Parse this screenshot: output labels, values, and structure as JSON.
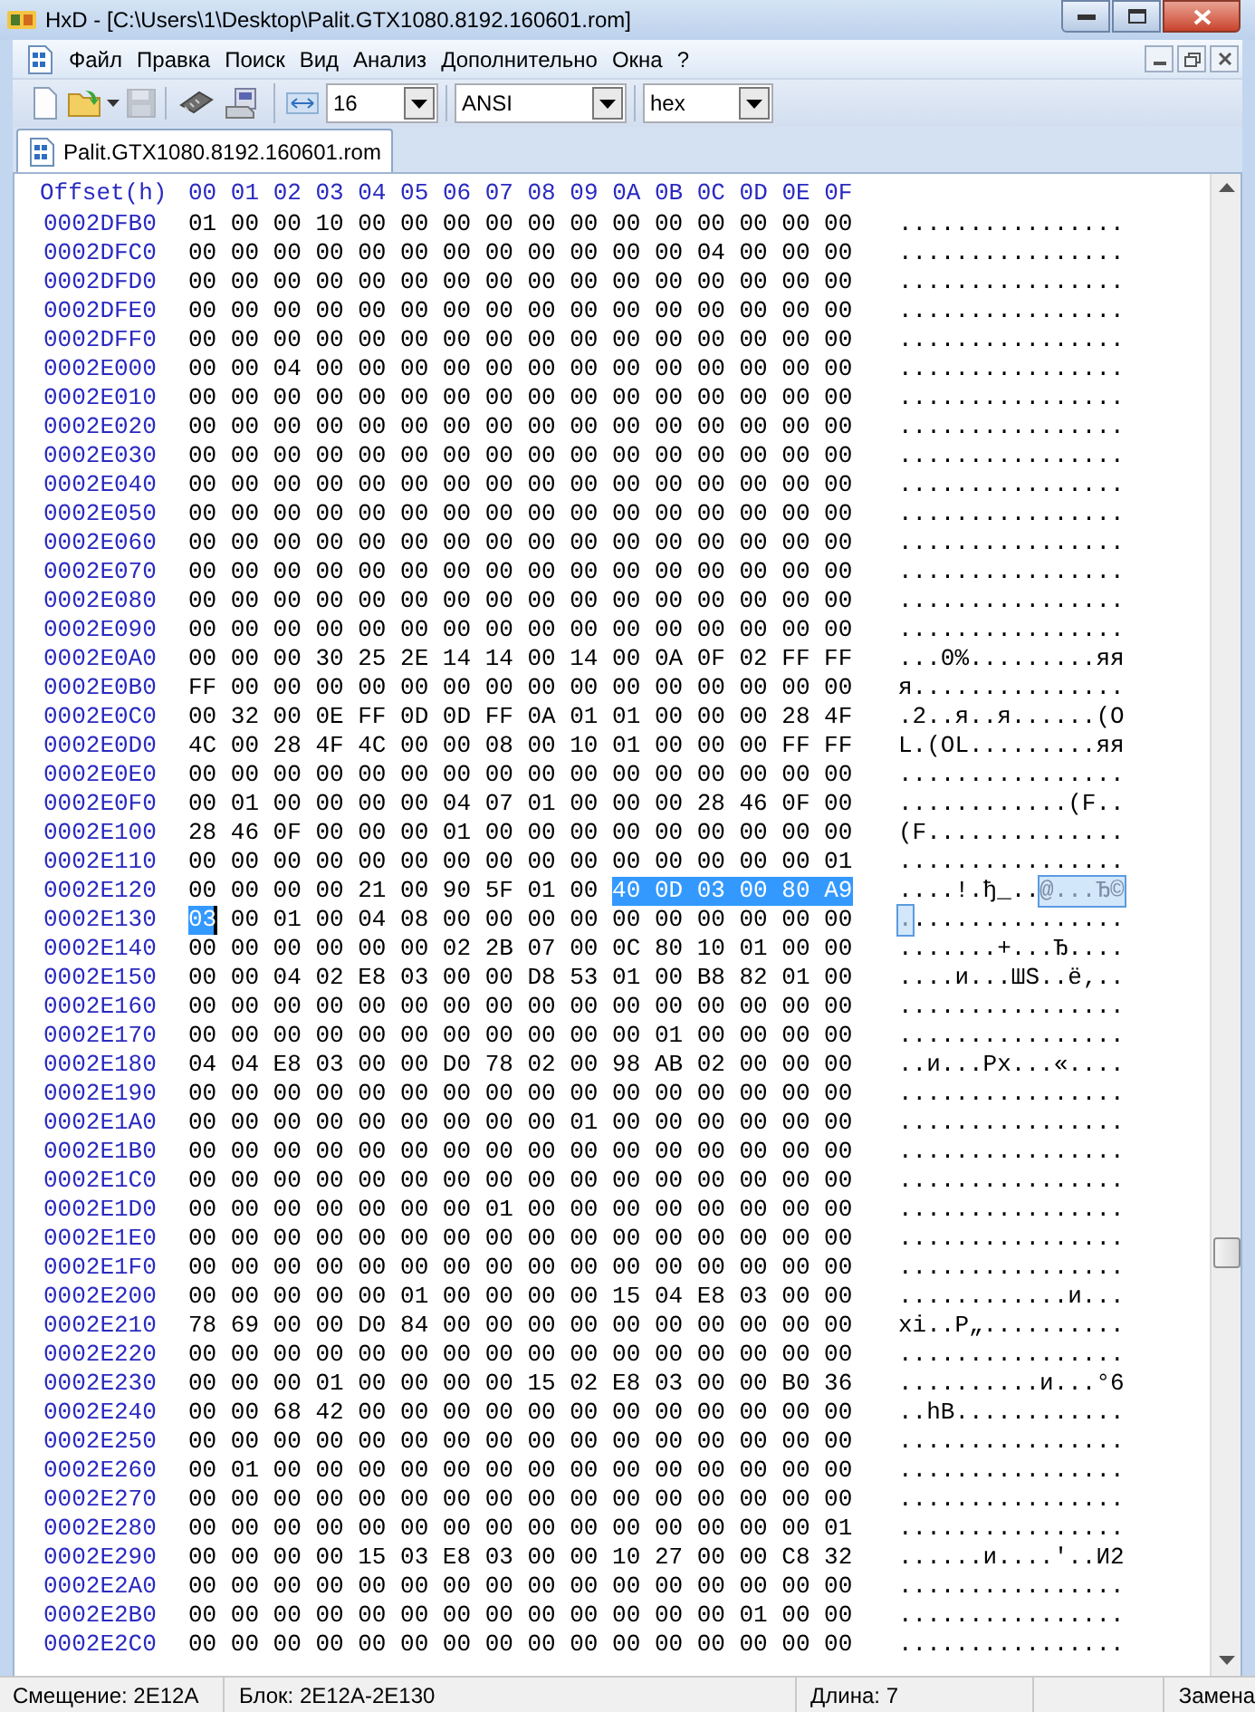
{
  "window": {
    "title": "HxD - [C:\\Users\\1\\Desktop\\Palit.GTX1080.8192.160601.rom]"
  },
  "menu": [
    "Файл",
    "Правка",
    "Поиск",
    "Вид",
    "Анализ",
    "Дополнительно",
    "Окна",
    "?"
  ],
  "toolbar": {
    "tools": [
      {
        "kind": "new",
        "disabled": false
      },
      {
        "kind": "open",
        "disabled": false
      },
      {
        "kind": "save",
        "disabled": true
      },
      {
        "kind": "ram",
        "disabled": false
      },
      {
        "kind": "disk",
        "disabled": false
      }
    ],
    "combos": [
      {
        "value": "16"
      },
      {
        "value": "ANSI"
      },
      {
        "value": "hex"
      }
    ]
  },
  "tabs": [
    {
      "label": "Palit.GTX1080.8192.160601.rom",
      "selected": true
    }
  ],
  "editor": {
    "offset_header": "Offset(h)",
    "hex_pane_focused": true,
    "columns": [
      "00",
      "01",
      "02",
      "03",
      "04",
      "05",
      "06",
      "07",
      "08",
      "09",
      "0A",
      "0B",
      "0C",
      "0D",
      "0E",
      "0F"
    ],
    "rows": [
      {
        "offset": "0002DFB0",
        "hex": [
          {
            "text": "01 00 00 10 00 00 00 00 00 00 00 00 00 00 00 00",
            "selected": false,
            "caret": false
          }
        ],
        "ascii": [
          {
            "text": "................",
            "selected": false
          }
        ]
      },
      {
        "offset": "0002DFC0",
        "hex": [
          {
            "text": "00 00 00 00 00 00 00 00 00 00 00 00 04 00 00 00",
            "selected": false,
            "caret": false
          }
        ],
        "ascii": [
          {
            "text": "................",
            "selected": false
          }
        ]
      },
      {
        "offset": "0002DFD0",
        "hex": [
          {
            "text": "00 00 00 00 00 00 00 00 00 00 00 00 00 00 00 00",
            "selected": false,
            "caret": false
          }
        ],
        "ascii": [
          {
            "text": "................",
            "selected": false
          }
        ]
      },
      {
        "offset": "0002DFE0",
        "hex": [
          {
            "text": "00 00 00 00 00 00 00 00 00 00 00 00 00 00 00 00",
            "selected": false,
            "caret": false
          }
        ],
        "ascii": [
          {
            "text": "................",
            "selected": false
          }
        ]
      },
      {
        "offset": "0002DFF0",
        "hex": [
          {
            "text": "00 00 00 00 00 00 00 00 00 00 00 00 00 00 00 00",
            "selected": false,
            "caret": false
          }
        ],
        "ascii": [
          {
            "text": "................",
            "selected": false
          }
        ]
      },
      {
        "offset": "0002E000",
        "hex": [
          {
            "text": "00 00 04 00 00 00 00 00 00 00 00 00 00 00 00 00",
            "selected": false,
            "caret": false
          }
        ],
        "ascii": [
          {
            "text": "................",
            "selected": false
          }
        ]
      },
      {
        "offset": "0002E010",
        "hex": [
          {
            "text": "00 00 00 00 00 00 00 00 00 00 00 00 00 00 00 00",
            "selected": false,
            "caret": false
          }
        ],
        "ascii": [
          {
            "text": "................",
            "selected": false
          }
        ]
      },
      {
        "offset": "0002E020",
        "hex": [
          {
            "text": "00 00 00 00 00 00 00 00 00 00 00 00 00 00 00 00",
            "selected": false,
            "caret": false
          }
        ],
        "ascii": [
          {
            "text": "................",
            "selected": false
          }
        ]
      },
      {
        "offset": "0002E030",
        "hex": [
          {
            "text": "00 00 00 00 00 00 00 00 00 00 00 00 00 00 00 00",
            "selected": false,
            "caret": false
          }
        ],
        "ascii": [
          {
            "text": "................",
            "selected": false
          }
        ]
      },
      {
        "offset": "0002E040",
        "hex": [
          {
            "text": "00 00 00 00 00 00 00 00 00 00 00 00 00 00 00 00",
            "selected": false,
            "caret": false
          }
        ],
        "ascii": [
          {
            "text": "................",
            "selected": false
          }
        ]
      },
      {
        "offset": "0002E050",
        "hex": [
          {
            "text": "00 00 00 00 00 00 00 00 00 00 00 00 00 00 00 00",
            "selected": false,
            "caret": false
          }
        ],
        "ascii": [
          {
            "text": "................",
            "selected": false
          }
        ]
      },
      {
        "offset": "0002E060",
        "hex": [
          {
            "text": "00 00 00 00 00 00 00 00 00 00 00 00 00 00 00 00",
            "selected": false,
            "caret": false
          }
        ],
        "ascii": [
          {
            "text": "................",
            "selected": false
          }
        ]
      },
      {
        "offset": "0002E070",
        "hex": [
          {
            "text": "00 00 00 00 00 00 00 00 00 00 00 00 00 00 00 00",
            "selected": false,
            "caret": false
          }
        ],
        "ascii": [
          {
            "text": "................",
            "selected": false
          }
        ]
      },
      {
        "offset": "0002E080",
        "hex": [
          {
            "text": "00 00 00 00 00 00 00 00 00 00 00 00 00 00 00 00",
            "selected": false,
            "caret": false
          }
        ],
        "ascii": [
          {
            "text": "................",
            "selected": false
          }
        ]
      },
      {
        "offset": "0002E090",
        "hex": [
          {
            "text": "00 00 00 00 00 00 00 00 00 00 00 00 00 00 00 00",
            "selected": false,
            "caret": false
          }
        ],
        "ascii": [
          {
            "text": "................",
            "selected": false
          }
        ]
      },
      {
        "offset": "0002E0A0",
        "hex": [
          {
            "text": "00 00 00 30 25 2E 14 14 00 14 00 0A 0F 02 FF FF",
            "selected": false,
            "caret": false
          }
        ],
        "ascii": [
          {
            "text": "...0%.........яя",
            "selected": false
          }
        ]
      },
      {
        "offset": "0002E0B0",
        "hex": [
          {
            "text": "FF 00 00 00 00 00 00 00 00 00 00 00 00 00 00 00",
            "selected": false,
            "caret": false
          }
        ],
        "ascii": [
          {
            "text": "я...............",
            "selected": false
          }
        ]
      },
      {
        "offset": "0002E0C0",
        "hex": [
          {
            "text": "00 32 00 0E FF 0D 0D FF 0A 01 01 00 00 00 28 4F",
            "selected": false,
            "caret": false
          }
        ],
        "ascii": [
          {
            "text": ".2..я..я......(O",
            "selected": false
          }
        ]
      },
      {
        "offset": "0002E0D0",
        "hex": [
          {
            "text": "4C 00 28 4F 4C 00 00 08 00 10 01 00 00 00 FF FF",
            "selected": false,
            "caret": false
          }
        ],
        "ascii": [
          {
            "text": "L.(OL.........яя",
            "selected": false
          }
        ]
      },
      {
        "offset": "0002E0E0",
        "hex": [
          {
            "text": "00 00 00 00 00 00 00 00 00 00 00 00 00 00 00 00",
            "selected": false,
            "caret": false
          }
        ],
        "ascii": [
          {
            "text": "................",
            "selected": false
          }
        ]
      },
      {
        "offset": "0002E0F0",
        "hex": [
          {
            "text": "00 01 00 00 00 00 04 07 01 00 00 00 28 46 0F 00",
            "selected": false,
            "caret": false
          }
        ],
        "ascii": [
          {
            "text": "............(F..",
            "selected": false
          }
        ]
      },
      {
        "offset": "0002E100",
        "hex": [
          {
            "text": "28 46 0F 00 00 00 01 00 00 00 00 00 00 00 00 00",
            "selected": false,
            "caret": false
          }
        ],
        "ascii": [
          {
            "text": "(F..............",
            "selected": false
          }
        ]
      },
      {
        "offset": "0002E110",
        "hex": [
          {
            "text": "00 00 00 00 00 00 00 00 00 00 00 00 00 00 00 01",
            "selected": false,
            "caret": false
          }
        ],
        "ascii": [
          {
            "text": "................",
            "selected": false
          }
        ]
      },
      {
        "offset": "0002E120",
        "hex": [
          {
            "text": "00 00 00 00 21 00 90 5F 01 00",
            "selected": false,
            "caret": false
          },
          {
            "text": "40 0D 03 00 80 A9",
            "selected": true,
            "caret": false
          }
        ],
        "ascii": [
          {
            "text": "....!.ђ_..",
            "selected": false
          },
          {
            "text": "@...Ђ©",
            "selected": true
          }
        ]
      },
      {
        "offset": "0002E130",
        "hex": [
          {
            "text": "03",
            "selected": true,
            "caret": true
          },
          {
            "text": "00 01 00 04 08 00 00 00 00 00 00 00 00 00 00",
            "selected": false,
            "caret": false
          }
        ],
        "ascii": [
          {
            "text": ".",
            "selected": true
          },
          {
            "text": "...............",
            "selected": false
          }
        ]
      },
      {
        "offset": "0002E140",
        "hex": [
          {
            "text": "00 00 00 00 00 00 02 2B 07 00 0C 80 10 01 00 00",
            "selected": false,
            "caret": false
          }
        ],
        "ascii": [
          {
            "text": ".......+...Ђ....",
            "selected": false
          }
        ]
      },
      {
        "offset": "0002E150",
        "hex": [
          {
            "text": "00 00 04 02 E8 03 00 00 D8 53 01 00 B8 82 01 00",
            "selected": false,
            "caret": false
          }
        ],
        "ascii": [
          {
            "text": "....и...ШS..ё‚..",
            "selected": false
          }
        ]
      },
      {
        "offset": "0002E160",
        "hex": [
          {
            "text": "00 00 00 00 00 00 00 00 00 00 00 00 00 00 00 00",
            "selected": false,
            "caret": false
          }
        ],
        "ascii": [
          {
            "text": "................",
            "selected": false
          }
        ]
      },
      {
        "offset": "0002E170",
        "hex": [
          {
            "text": "00 00 00 00 00 00 00 00 00 00 00 01 00 00 00 00",
            "selected": false,
            "caret": false
          }
        ],
        "ascii": [
          {
            "text": "................",
            "selected": false
          }
        ]
      },
      {
        "offset": "0002E180",
        "hex": [
          {
            "text": "04 04 E8 03 00 00 D0 78 02 00 98 AB 02 00 00 00",
            "selected": false,
            "caret": false
          }
        ],
        "ascii": [
          {
            "text": "..и...Рx...«....",
            "selected": false
          }
        ]
      },
      {
        "offset": "0002E190",
        "hex": [
          {
            "text": "00 00 00 00 00 00 00 00 00 00 00 00 00 00 00 00",
            "selected": false,
            "caret": false
          }
        ],
        "ascii": [
          {
            "text": "................",
            "selected": false
          }
        ]
      },
      {
        "offset": "0002E1A0",
        "hex": [
          {
            "text": "00 00 00 00 00 00 00 00 00 01 00 00 00 00 00 00",
            "selected": false,
            "caret": false
          }
        ],
        "ascii": [
          {
            "text": "................",
            "selected": false
          }
        ]
      },
      {
        "offset": "0002E1B0",
        "hex": [
          {
            "text": "00 00 00 00 00 00 00 00 00 00 00 00 00 00 00 00",
            "selected": false,
            "caret": false
          }
        ],
        "ascii": [
          {
            "text": "................",
            "selected": false
          }
        ]
      },
      {
        "offset": "0002E1C0",
        "hex": [
          {
            "text": "00 00 00 00 00 00 00 00 00 00 00 00 00 00 00 00",
            "selected": false,
            "caret": false
          }
        ],
        "ascii": [
          {
            "text": "................",
            "selected": false
          }
        ]
      },
      {
        "offset": "0002E1D0",
        "hex": [
          {
            "text": "00 00 00 00 00 00 00 01 00 00 00 00 00 00 00 00",
            "selected": false,
            "caret": false
          }
        ],
        "ascii": [
          {
            "text": "................",
            "selected": false
          }
        ]
      },
      {
        "offset": "0002E1E0",
        "hex": [
          {
            "text": "00 00 00 00 00 00 00 00 00 00 00 00 00 00 00 00",
            "selected": false,
            "caret": false
          }
        ],
        "ascii": [
          {
            "text": "................",
            "selected": false
          }
        ]
      },
      {
        "offset": "0002E1F0",
        "hex": [
          {
            "text": "00 00 00 00 00 00 00 00 00 00 00 00 00 00 00 00",
            "selected": false,
            "caret": false
          }
        ],
        "ascii": [
          {
            "text": "................",
            "selected": false
          }
        ]
      },
      {
        "offset": "0002E200",
        "hex": [
          {
            "text": "00 00 00 00 00 01 00 00 00 00 15 04 E8 03 00 00",
            "selected": false,
            "caret": false
          }
        ],
        "ascii": [
          {
            "text": "............и...",
            "selected": false
          }
        ]
      },
      {
        "offset": "0002E210",
        "hex": [
          {
            "text": "78 69 00 00 D0 84 00 00 00 00 00 00 00 00 00 00",
            "selected": false,
            "caret": false
          }
        ],
        "ascii": [
          {
            "text": "xi..Р„..........",
            "selected": false
          }
        ]
      },
      {
        "offset": "0002E220",
        "hex": [
          {
            "text": "00 00 00 00 00 00 00 00 00 00 00 00 00 00 00 00",
            "selected": false,
            "caret": false
          }
        ],
        "ascii": [
          {
            "text": "................",
            "selected": false
          }
        ]
      },
      {
        "offset": "0002E230",
        "hex": [
          {
            "text": "00 00 00 01 00 00 00 00 15 02 E8 03 00 00 B0 36",
            "selected": false,
            "caret": false
          }
        ],
        "ascii": [
          {
            "text": "..........и...°6",
            "selected": false
          }
        ]
      },
      {
        "offset": "0002E240",
        "hex": [
          {
            "text": "00 00 68 42 00 00 00 00 00 00 00 00 00 00 00 00",
            "selected": false,
            "caret": false
          }
        ],
        "ascii": [
          {
            "text": "..hB............",
            "selected": false
          }
        ]
      },
      {
        "offset": "0002E250",
        "hex": [
          {
            "text": "00 00 00 00 00 00 00 00 00 00 00 00 00 00 00 00",
            "selected": false,
            "caret": false
          }
        ],
        "ascii": [
          {
            "text": "................",
            "selected": false
          }
        ]
      },
      {
        "offset": "0002E260",
        "hex": [
          {
            "text": "00 01 00 00 00 00 00 00 00 00 00 00 00 00 00 00",
            "selected": false,
            "caret": false
          }
        ],
        "ascii": [
          {
            "text": "................",
            "selected": false
          }
        ]
      },
      {
        "offset": "0002E270",
        "hex": [
          {
            "text": "00 00 00 00 00 00 00 00 00 00 00 00 00 00 00 00",
            "selected": false,
            "caret": false
          }
        ],
        "ascii": [
          {
            "text": "................",
            "selected": false
          }
        ]
      },
      {
        "offset": "0002E280",
        "hex": [
          {
            "text": "00 00 00 00 00 00 00 00 00 00 00 00 00 00 00 01",
            "selected": false,
            "caret": false
          }
        ],
        "ascii": [
          {
            "text": "................",
            "selected": false
          }
        ]
      },
      {
        "offset": "0002E290",
        "hex": [
          {
            "text": "00 00 00 00 15 03 E8 03 00 00 10 27 00 00 C8 32",
            "selected": false,
            "caret": false
          }
        ],
        "ascii": [
          {
            "text": "......и....'..И2",
            "selected": false
          }
        ]
      },
      {
        "offset": "0002E2A0",
        "hex": [
          {
            "text": "00 00 00 00 00 00 00 00 00 00 00 00 00 00 00 00",
            "selected": false,
            "caret": false
          }
        ],
        "ascii": [
          {
            "text": "................",
            "selected": false
          }
        ]
      },
      {
        "offset": "0002E2B0",
        "hex": [
          {
            "text": "00 00 00 00 00 00 00 00 00 00 00 00 00 01 00 00",
            "selected": false,
            "caret": false
          }
        ],
        "ascii": [
          {
            "text": "................",
            "selected": false
          }
        ]
      },
      {
        "offset": "0002E2C0",
        "hex": [
          {
            "text": "00 00 00 00 00 00 00 00 00 00 00 00 00 00 00 00",
            "selected": false,
            "caret": false
          }
        ],
        "ascii": [
          {
            "text": "................",
            "selected": false
          }
        ]
      }
    ]
  },
  "status_bar": [
    "Смещение: 2E12A",
    "Блок: 2E12A-2E130",
    "Длина: 7",
    "Замена"
  ]
}
